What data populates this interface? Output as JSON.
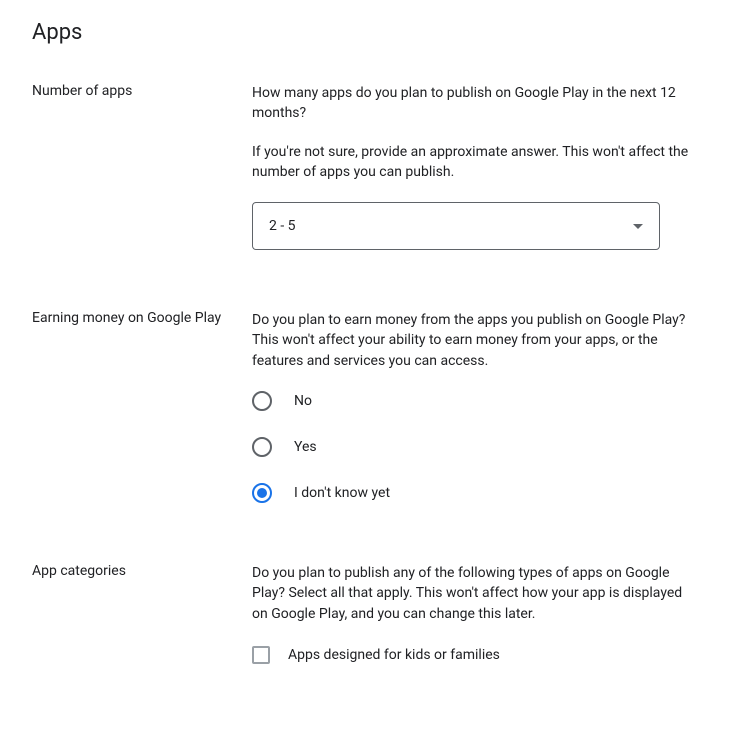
{
  "title": "Apps",
  "sections": {
    "numApps": {
      "label": "Number of apps",
      "desc1": "How many apps do you plan to publish on Google Play in the next 12 months?",
      "desc2": "If you're not sure, provide an approximate answer. This won't affect the number of apps you can publish.",
      "selectedValue": "2 - 5"
    },
    "earning": {
      "label": "Earning money on Google Play",
      "desc": "Do you plan to earn money from the apps you publish on Google Play? This won't affect your ability to earn money from your apps, or the features and services you can access.",
      "options": {
        "no": "No",
        "yes": "Yes",
        "unknown": "I don't know yet"
      }
    },
    "categories": {
      "label": "App categories",
      "desc": "Do you plan to publish any of the following types of apps on Google Play? Select all that apply. This won't affect how your app is displayed on Google Play, and you can change this later.",
      "options": {
        "kids": "Apps designed for kids or families"
      }
    }
  }
}
